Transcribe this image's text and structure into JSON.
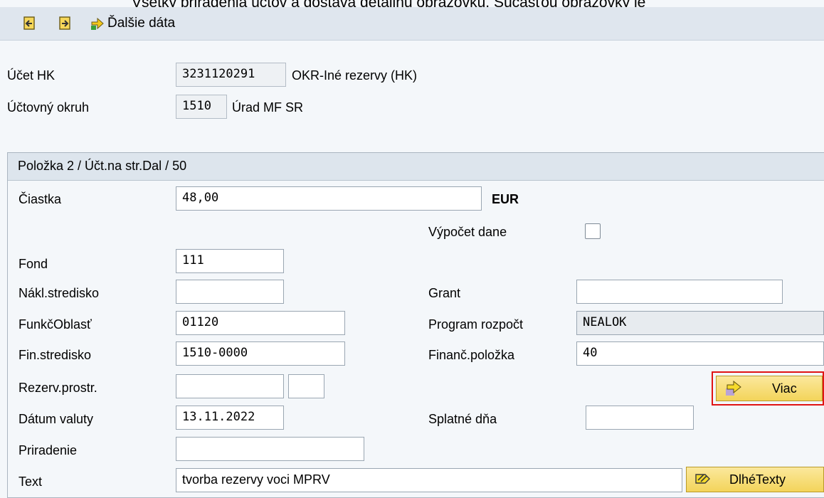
{
  "top_text": "Všetky priradenia účtov a dostáva detailnú obrazovku. Súčasťou obrazovky je",
  "toolbar": {
    "prev_icon": "previous-item-icon",
    "next_icon": "next-item-icon",
    "more_data_label": "Ďalšie dáta"
  },
  "header": {
    "account_label": "Účet HK",
    "account_value": "3231120291",
    "account_desc": "OKR-Iné rezervy (HK)",
    "company_label": "Účtovný okruh",
    "company_value": "1510",
    "company_desc": "Úrad MF SR"
  },
  "section": {
    "title": "Položka 2 / Účt.na str.Dal / 50"
  },
  "fields": {
    "amount_label": "Čiastka",
    "amount_value": "48,00",
    "currency": "EUR",
    "tax_label": "Výpočet dane",
    "fund_label": "Fond",
    "fund_value": "111",
    "cost_center_label": "Nákl.stredisko",
    "cost_center_value": "",
    "grant_label": "Grant",
    "grant_value": "",
    "func_area_label": "FunkčOblasť",
    "func_area_value": "01120",
    "budget_program_label": "Program rozpočt",
    "budget_program_value": "NEALOK",
    "fin_center_label": "Fin.stredisko",
    "fin_center_value": "1510-0000",
    "fin_item_label": "Finanč.položka",
    "fin_item_value": "40",
    "reserve_label": "Rezerv.prostr.",
    "reserve_value": "",
    "reserve_value2": "",
    "value_date_label": "Dátum valuty",
    "value_date_value": "13.11.2022",
    "due_days_label": "Splatné dňa",
    "due_days_value": "",
    "assignment_label": "Priradenie",
    "assignment_value": "",
    "text_label": "Text",
    "text_value": "tvorba rezervy voci MPRV"
  },
  "buttons": {
    "more_label": "Viac",
    "long_texts_label": "DlhéTexty"
  },
  "colors": {
    "highlight": "#e01414",
    "button_fill": "#f3d45a"
  }
}
